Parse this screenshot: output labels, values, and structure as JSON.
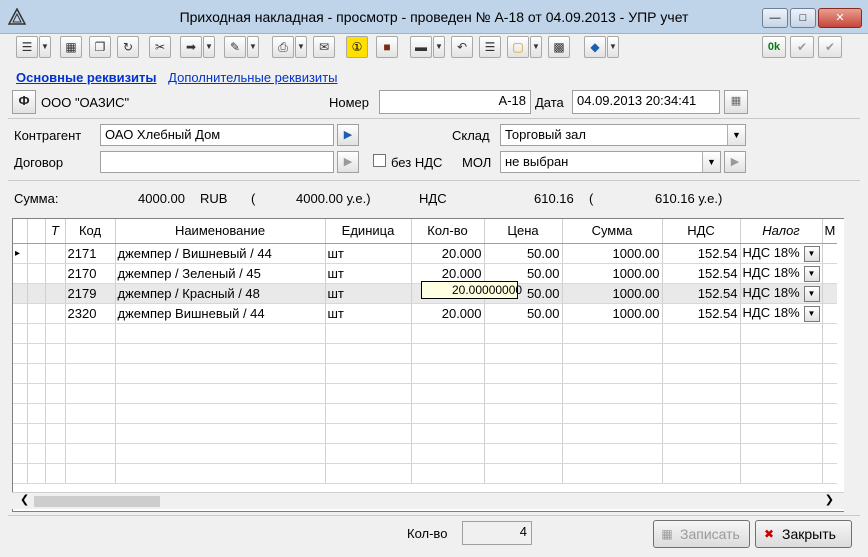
{
  "window": {
    "title": "Приходная накладная - просмотр - проведен № А-18 от 04.09.2013 - УПР учет"
  },
  "tabs": {
    "active": "Основные реквизиты",
    "other": "Дополнительные реквизиты"
  },
  "header": {
    "org_button": "Ф",
    "org_name": "ООО \"ОАЗИС\"",
    "number_label": "Номер",
    "number_value": "А-18",
    "date_label": "Дата",
    "date_value": "04.09.2013 20:34:41"
  },
  "form": {
    "counterparty_label": "Контрагент",
    "counterparty_value": "ОАО Хлебный Дом",
    "contract_label": "Договор",
    "contract_value": "",
    "no_vat_label": "без НДС",
    "warehouse_label": "Склад",
    "warehouse_value": "Торговый зал",
    "mol_label": "МОЛ",
    "mol_value": "не выбран"
  },
  "summary": {
    "sum_label": "Сумма:",
    "sum_value": "4000.00",
    "currency": "RUB",
    "open_paren": "(",
    "ue_value": "4000.00 у.е.)",
    "vat_label": "НДС",
    "vat_value": "610.16",
    "open_paren2": "(",
    "vat_ue_value": "610.16 у.е.)"
  },
  "table": {
    "columns": [
      "",
      "Т",
      "Код",
      "Наименование",
      "Единица",
      "Кол-во",
      "Цена",
      "Сумма",
      "НДС",
      "Налог",
      "М"
    ],
    "rows": [
      {
        "code": "2171",
        "name": "джемпер  / Вишневый / 44",
        "unit": "шт",
        "qty": "20.000",
        "price": "50.00",
        "sum": "1000.00",
        "vat": "152.54",
        "tax": "НДС 18%"
      },
      {
        "code": "2170",
        "name": "джемпер  / Зеленый / 45",
        "unit": "шт",
        "qty": "20.000",
        "price": "50.00",
        "sum": "1000.00",
        "vat": "152.54",
        "tax": "НДС 18%"
      },
      {
        "code": "2179",
        "name": "джемпер  / Красный / 48",
        "unit": "шт",
        "qty": "",
        "price": "50.00",
        "sum": "1000.00",
        "vat": "152.54",
        "tax": "НДС 18%"
      },
      {
        "code": "2320",
        "name": "джемпер Вишневый / 44",
        "unit": "шт",
        "qty": "20.000",
        "price": "50.00",
        "sum": "1000.00",
        "vat": "152.54",
        "tax": "НДС 18%"
      }
    ],
    "tooltip": "20.00000000"
  },
  "footer": {
    "qty_label": "Кол-во",
    "qty_value": "4",
    "save_label": "Записать",
    "close_label": "Закрыть"
  },
  "toolbar": {
    "ok_label": "0k"
  }
}
